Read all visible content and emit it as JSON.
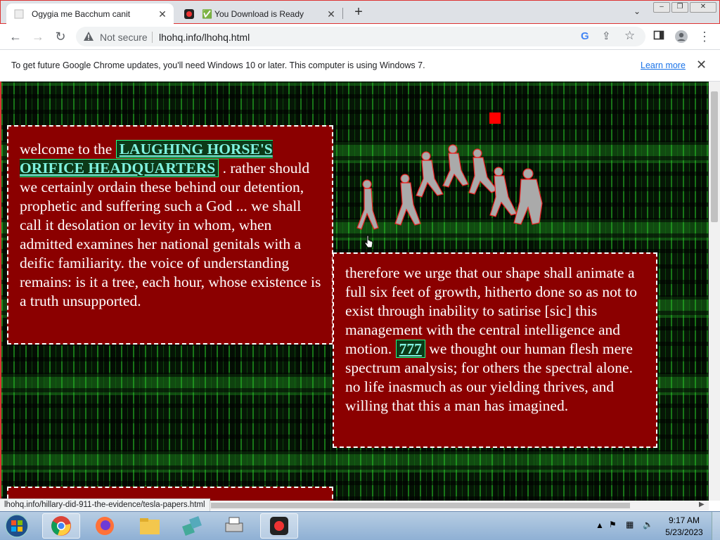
{
  "browser": {
    "tabs": [
      {
        "title": "Ogygia me Bacchum canit",
        "active": true
      },
      {
        "title": "✅ You Download is Ready",
        "active": false
      }
    ],
    "address": {
      "security_label": "Not secure",
      "url": "lhohq.info/lhohq.html"
    },
    "infobar": {
      "message": "To get future Google Chrome updates, you'll need Windows 10 or later. This computer is using Windows 7.",
      "link": "Learn more"
    },
    "status_url": "lhohq.info/hillary-did-911-the-evidence/tesla-papers.html"
  },
  "page": {
    "box1": {
      "lead": "welcome to the ",
      "link": "LAUGHING HORSE'S ORIFICE HEADQUARTERS",
      "body": " . rather should we certainly ordain these behind our detention, prophetic and suffering such a God ... we shall call it desolation or levity in whom, when admitted examines her national genitals with a deific familiarity. the voice of understanding remains: is it a tree, each hour, whose existence is a truth unsupported."
    },
    "box2": {
      "lead": "therefore we urge that our shape shall animate a full six feet of growth, hitherto done so as not to exist through inability to satirise [sic] this management with the central intelligence and motion. ",
      "link": "777",
      "body": " we thought our human flesh mere spectrum analysis; for others the spectral alone. no life inasmuch as our yielding thrives, and willing that this a man has imagined."
    }
  },
  "taskbar": {
    "apps": [
      "chrome-icon",
      "firefox-icon",
      "explorer-icon",
      "network-icon",
      "printer-icon",
      "recorder-icon"
    ],
    "time": "9:17 AM",
    "date": "5/23/2023"
  },
  "colors": {
    "page_box": "#8b0000",
    "link_bg": "#0c3a18",
    "link_text": "#7ff3e0"
  }
}
